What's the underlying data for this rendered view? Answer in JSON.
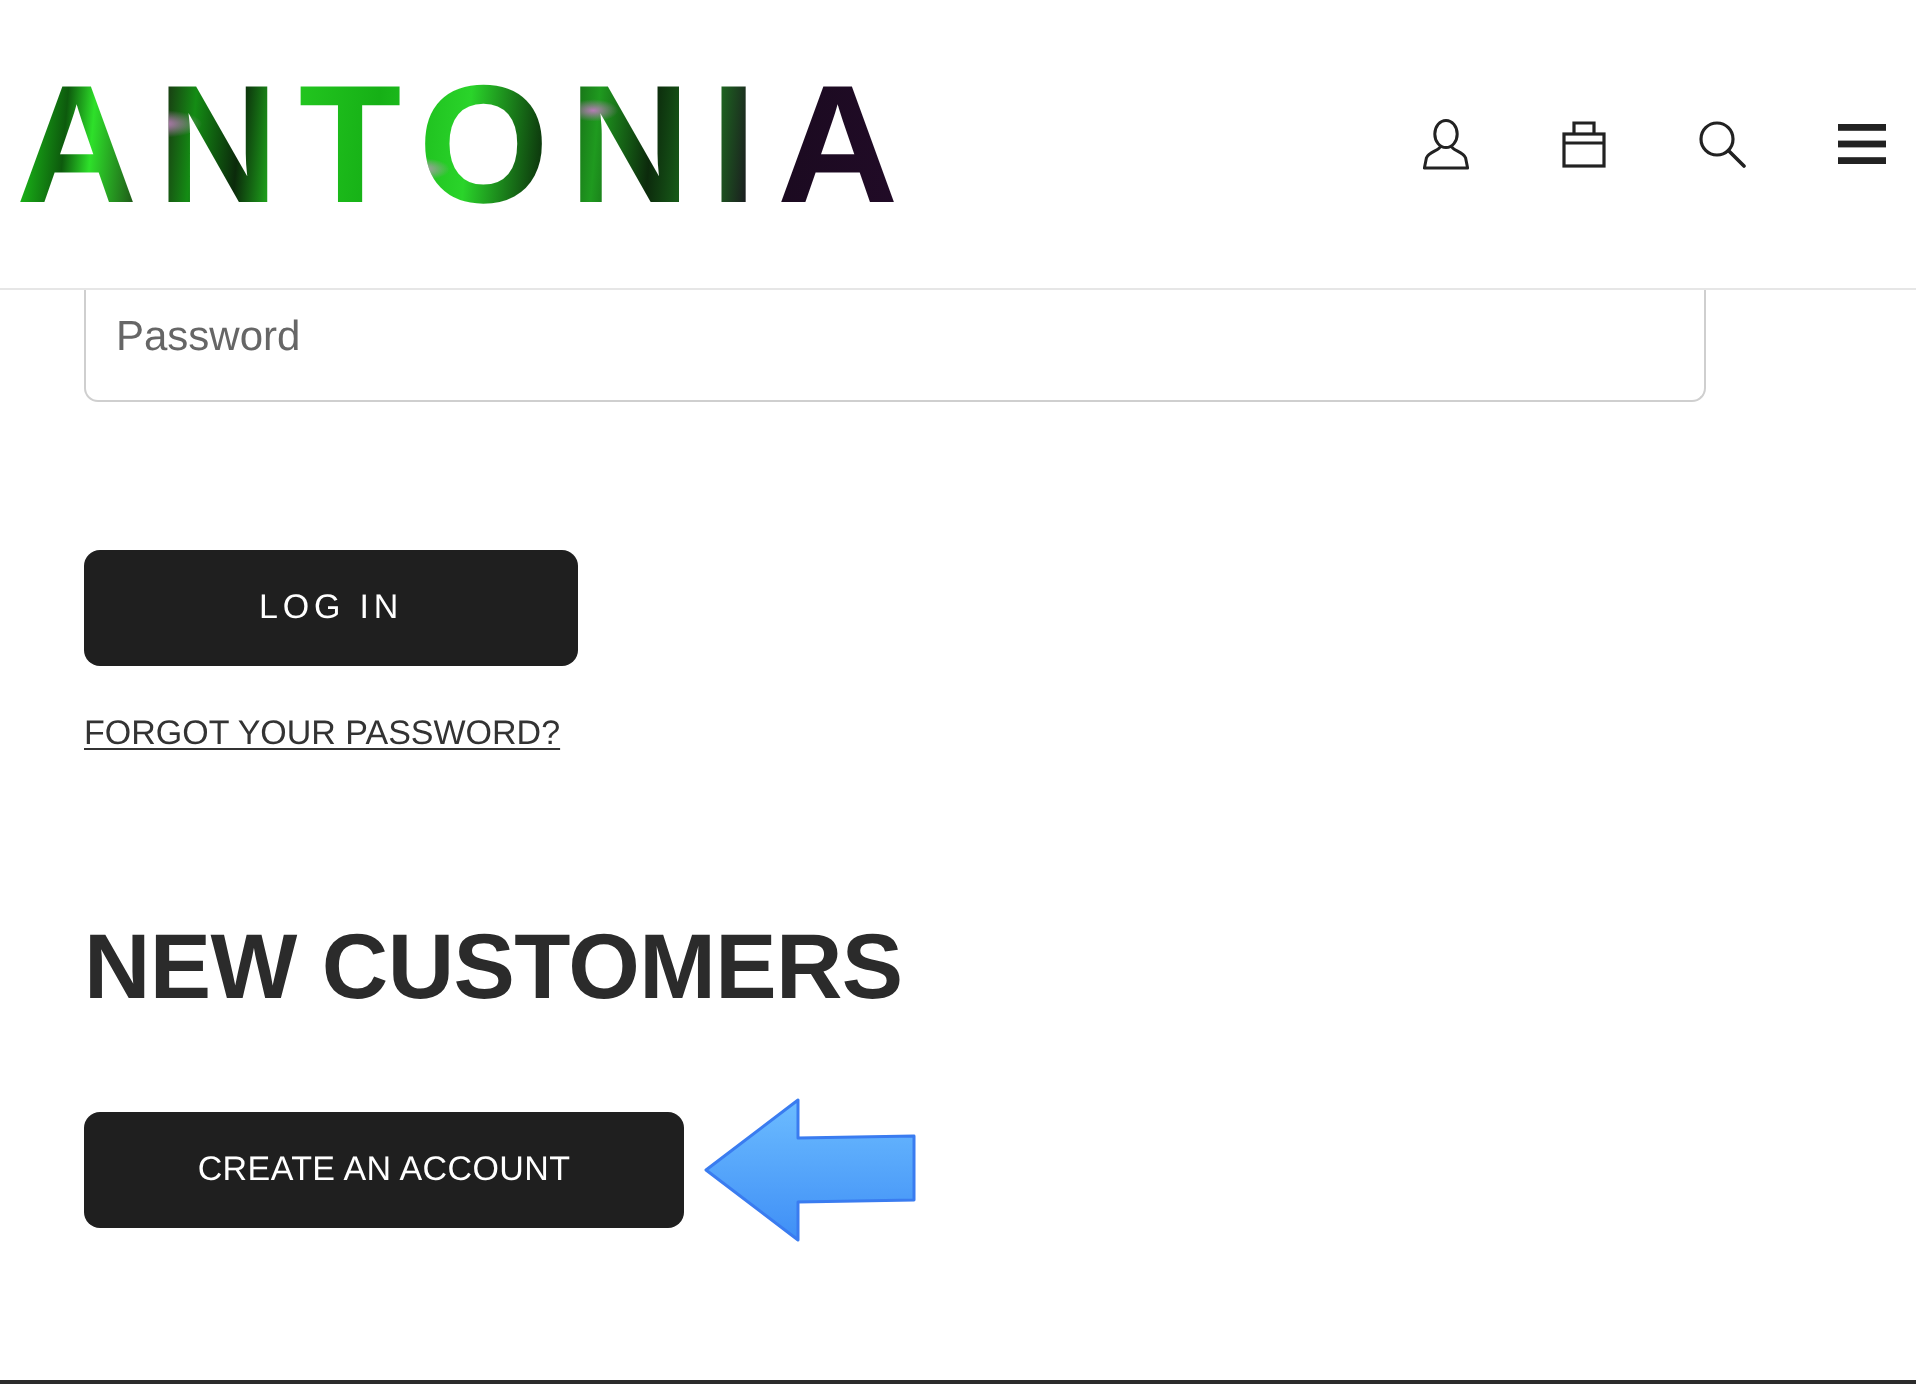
{
  "header": {
    "logo": "ANTONIA"
  },
  "login_form": {
    "password": {
      "placeholder": "Password"
    },
    "submit": "LOG IN",
    "forgot_link": "FORGOT YOUR PASSWORD?"
  },
  "new_customers": {
    "heading": "NEW CUSTOMERS",
    "create_button": "CREATE AN ACCOUNT"
  }
}
